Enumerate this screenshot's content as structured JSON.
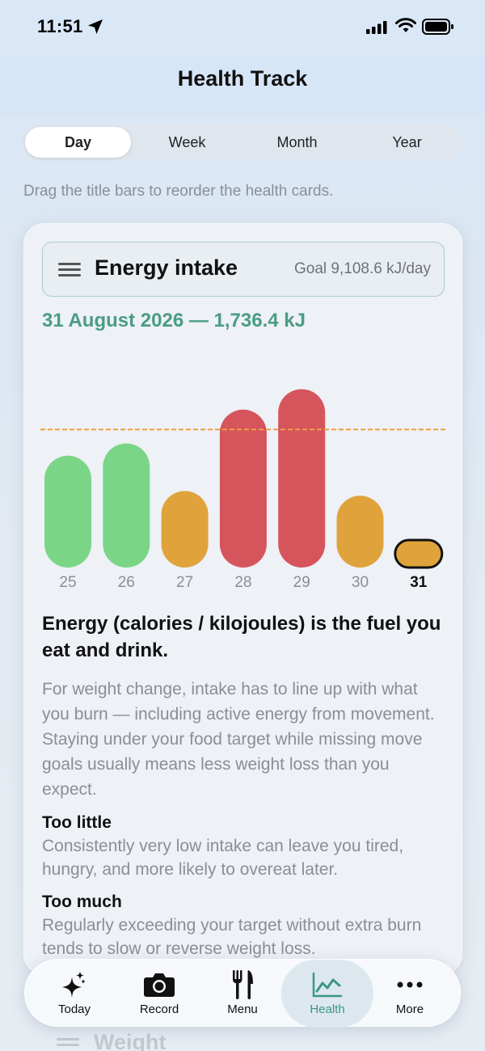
{
  "status_bar": {
    "time": "11:51"
  },
  "header": {
    "title": "Health Track"
  },
  "segments": [
    {
      "label": "Day",
      "active": true
    },
    {
      "label": "Week",
      "active": false
    },
    {
      "label": "Month",
      "active": false
    },
    {
      "label": "Year",
      "active": false
    }
  ],
  "hint": "Drag the title bars to reorder the health cards.",
  "card": {
    "title": "Energy intake",
    "goal": "Goal 9,108.6 kJ/day",
    "summary": "31 August 2026 — 1,736.4 kJ",
    "lead": "Energy (calories / kilojoules) is the fuel you eat and drink.",
    "paragraph": "For weight change, intake has to line up with what you burn — including active energy from movement. Staying under your food target while missing move goals usually means less weight loss than you expect.",
    "too_little_title": "Too little",
    "too_little_text": "Consistently very low intake can leave you tired, hungry, and more likely to overeat later.",
    "too_much_title": "Too much",
    "too_much_text": "Regularly exceeding your target without extra burn tends to slow or reverse weight loss."
  },
  "next_card_title": "Weight",
  "chart_data": {
    "type": "bar",
    "categories": [
      "25",
      "26",
      "27",
      "28",
      "29",
      "30",
      "31"
    ],
    "values": [
      7380,
      8190,
      5050,
      10420,
      11770,
      4740,
      1736.4
    ],
    "goal": 9108.6,
    "selected": "31",
    "ylim": [
      0,
      12800
    ],
    "colors": {
      "under": "#7ad686",
      "near": "#e0a33c",
      "over": "#d6555d",
      "goal_line": "#f0a040",
      "selected_outline": "#111111"
    },
    "bar_colors": [
      "under",
      "under",
      "near",
      "over",
      "over",
      "near",
      "near"
    ]
  },
  "tabs": [
    {
      "label": "Today",
      "icon": "sparkles-icon",
      "active": false
    },
    {
      "label": "Record",
      "icon": "camera-icon",
      "active": false
    },
    {
      "label": "Menu",
      "icon": "fork-knife-icon",
      "active": false
    },
    {
      "label": "Health",
      "icon": "chart-line-icon",
      "active": true
    },
    {
      "label": "More",
      "icon": "ellipsis-icon",
      "active": false
    }
  ],
  "colors": {
    "accent": "#4a9c85",
    "active_tab_bg": "#dde8ee"
  }
}
